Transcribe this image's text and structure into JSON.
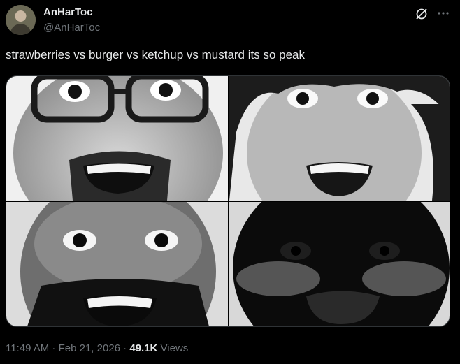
{
  "author": {
    "display_name": "AnHarToc",
    "handle": "@AnHarToc",
    "avatar_icon": "avatar-photo"
  },
  "tweet": {
    "text": "strawberries vs burger vs ketchup vs mustard its so peak"
  },
  "media": {
    "images": [
      {
        "description_icon": "face-glasses-photo"
      },
      {
        "description_icon": "face-curly-hair-photo"
      },
      {
        "description_icon": "face-bald-beard-photo"
      },
      {
        "description_icon": "face-dark-silhouette-photo"
      }
    ]
  },
  "meta": {
    "time": "11:49 AM",
    "separator": " · ",
    "date": "Feb 21, 2026",
    "views_count": "49.1K",
    "views_label": " Views"
  },
  "actions": {
    "grok_icon": "grok-icon",
    "more_icon": "more-dots-icon"
  },
  "colors": {
    "background": "#000000",
    "primary_text": "#e7e9ea",
    "secondary_text": "#71767b",
    "border": "#2f3336"
  }
}
